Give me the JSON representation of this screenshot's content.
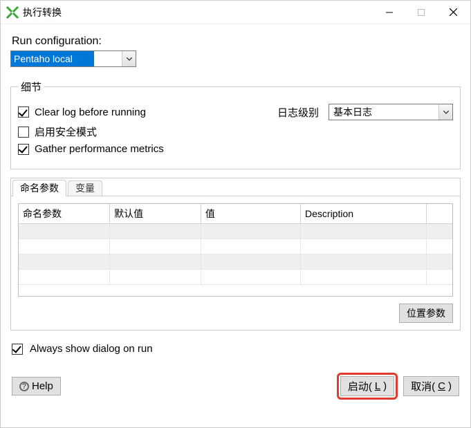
{
  "window": {
    "title": "执行转换"
  },
  "run_config": {
    "label": "Run configuration:",
    "selected": "Pentaho local"
  },
  "details": {
    "legend": "细节",
    "clear_log": {
      "label": "Clear log before running",
      "checked": true
    },
    "safe_mode": {
      "label": "启用安全模式",
      "checked": false
    },
    "gather_metrics": {
      "label": "Gather performance metrics",
      "checked": true
    },
    "log_level_label": "日志级别",
    "log_level_value": "基本日志"
  },
  "params": {
    "tabs": {
      "named": "命名参数",
      "vars": "变量"
    },
    "headers": {
      "name": "命名参数",
      "default": "默认值",
      "value": "值",
      "description": "Description"
    },
    "position_params_btn": "位置参数"
  },
  "always_show": {
    "label": "Always show dialog on run",
    "checked": true
  },
  "footer": {
    "help": "Help",
    "launch_pre": "启动(",
    "launch_u": "L",
    "launch_post": ")",
    "cancel_pre": "取消(",
    "cancel_u": "C",
    "cancel_post": ")"
  }
}
